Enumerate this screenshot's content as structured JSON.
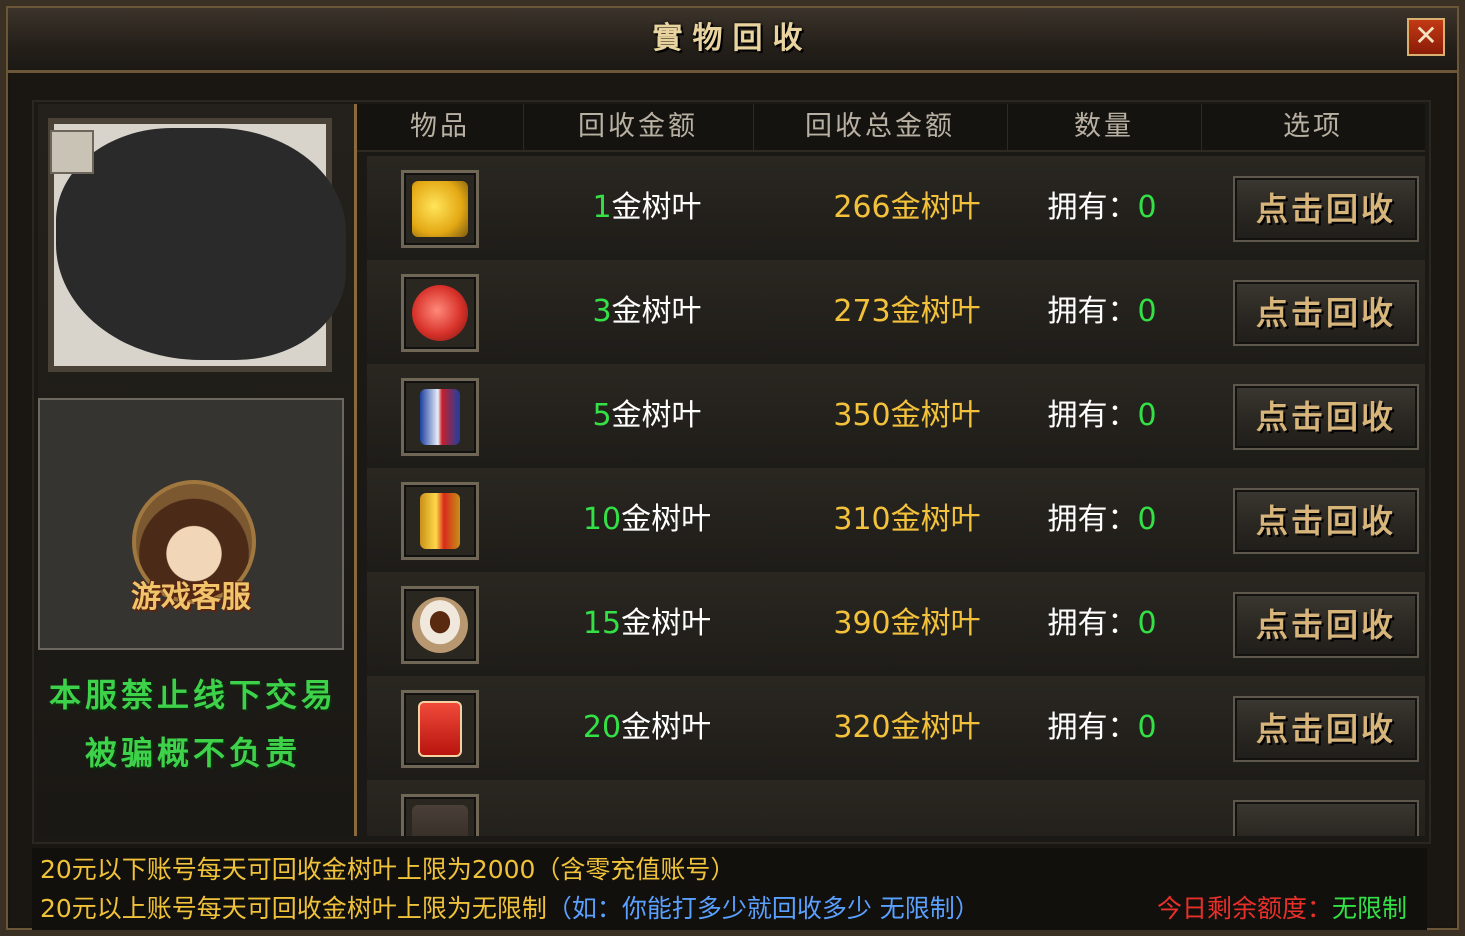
{
  "window": {
    "title": "實物回收",
    "close_label": "✕"
  },
  "left_panel": {
    "service_label": "游戏客服",
    "notice_line1": "本服禁止线下交易",
    "notice_line2": "被骗概不负责"
  },
  "table": {
    "headers": [
      "物品",
      "回收金额",
      "回收总金额",
      "数量",
      "选项"
    ],
    "rows": [
      {
        "item_icon": "banana-icon",
        "price_num": "1",
        "price_unit": "金树叶",
        "total": "266金树叶",
        "own_label": "拥有：",
        "own_count": "0",
        "button": "点击回收"
      },
      {
        "item_icon": "peach-icon",
        "price_num": "3",
        "price_unit": "金树叶",
        "total": "273金树叶",
        "own_label": "拥有：",
        "own_count": "0",
        "button": "点击回收"
      },
      {
        "item_icon": "pepsi-can-icon",
        "price_num": "5",
        "price_unit": "金树叶",
        "total": "350金树叶",
        "own_label": "拥有：",
        "own_count": "0",
        "button": "点击回收"
      },
      {
        "item_icon": "energy-drink-icon",
        "price_num": "10",
        "price_unit": "金树叶",
        "total": "310金树叶",
        "own_label": "拥有：",
        "own_count": "0",
        "button": "点击回收"
      },
      {
        "item_icon": "coffee-cup-icon",
        "price_num": "15",
        "price_unit": "金树叶",
        "total": "390金树叶",
        "own_label": "拥有：",
        "own_count": "0",
        "button": "点击回收"
      },
      {
        "item_icon": "cigarette-pack-icon",
        "price_num": "20",
        "price_unit": "金树叶",
        "total": "320金树叶",
        "own_label": "拥有：",
        "own_count": "0",
        "button": "点击回收"
      }
    ]
  },
  "footer": {
    "line1": "20元以下账号每天可回收金树叶上限为2000（含零充值账号）",
    "line2_main": "20元以上账号每天可回收金树叶上限为无限制",
    "line2_note": "（如：你能打多少就回收多少 无限制）",
    "quota_label": "今日剩余额度：",
    "quota_value": "无限制"
  },
  "colors": {
    "gold": "#f3c23a",
    "green": "#33e046",
    "red": "#e8302a",
    "blue": "#5aa0ff"
  }
}
